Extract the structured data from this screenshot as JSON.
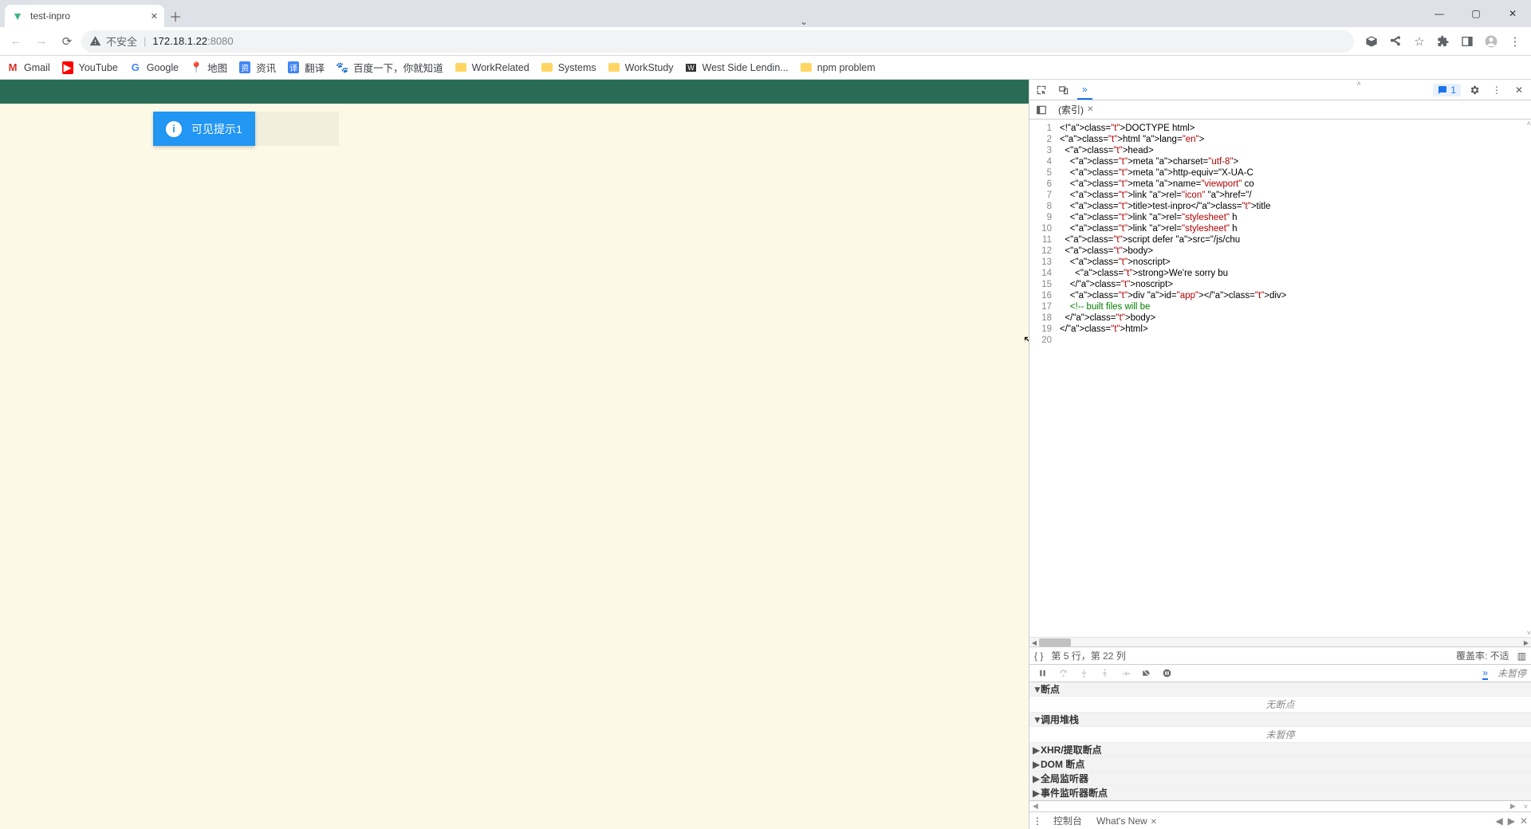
{
  "tab": {
    "title": "test-inpro"
  },
  "address": {
    "warn_label": "不安全",
    "host": "172.18.1.22",
    "port": ":8080"
  },
  "bookmarks": [
    {
      "icon": "gmail",
      "label": "Gmail"
    },
    {
      "icon": "youtube",
      "label": "YouTube"
    },
    {
      "icon": "google",
      "label": "Google"
    },
    {
      "icon": "maps",
      "label": "地图"
    },
    {
      "icon": "news",
      "label": "资讯"
    },
    {
      "icon": "trans",
      "label": "翻译"
    },
    {
      "icon": "baidu",
      "label": "百度一下，你就知道"
    },
    {
      "icon": "folder",
      "label": "WorkRelated"
    },
    {
      "icon": "folder",
      "label": "Systems"
    },
    {
      "icon": "folder",
      "label": "WorkStudy"
    },
    {
      "icon": "ws",
      "label": "West Side Lendin..."
    },
    {
      "icon": "folder",
      "label": "npm problem"
    }
  ],
  "alert": {
    "text": "可见提示1"
  },
  "devtools": {
    "issue_count": "1",
    "source_tab": "(索引)",
    "code_lines": [
      "<!DOCTYPE html>",
      "<html lang=\"en\">",
      "  <head>",
      "    <meta charset=\"utf-8\">",
      "    <meta http-equiv=\"X-UA-C",
      "    <meta name=\"viewport\" co",
      "    <link rel=\"icon\" href=\"/",
      "    <title>test-inpro</title",
      "    <link rel=\"stylesheet\" h",
      "    <link rel=\"stylesheet\" h",
      "  <script defer src=\"/js/chu",
      "  <body>",
      "    <noscript>",
      "      <strong>We're sorry bu",
      "    </noscript>",
      "    <div id=\"app\"></div>",
      "    <!-- built files will be",
      "  </body>",
      "</html>",
      ""
    ],
    "status": {
      "pos": "第 5 行，第 22 列",
      "coverage": "覆盖率: 不适"
    },
    "right_status": "未暂停",
    "panes": {
      "breakpoints": {
        "title": "断点",
        "empty": "无断点"
      },
      "callstack": {
        "title": "调用堆栈",
        "empty": "未暂停"
      },
      "xhr": {
        "title": "XHR/提取断点"
      },
      "dom": {
        "title": "DOM 断点"
      },
      "global": {
        "title": "全局监听器"
      },
      "event": {
        "title": "事件监听器断点"
      }
    },
    "drawer": {
      "console": "控制台",
      "whatsnew": "What's New"
    }
  }
}
